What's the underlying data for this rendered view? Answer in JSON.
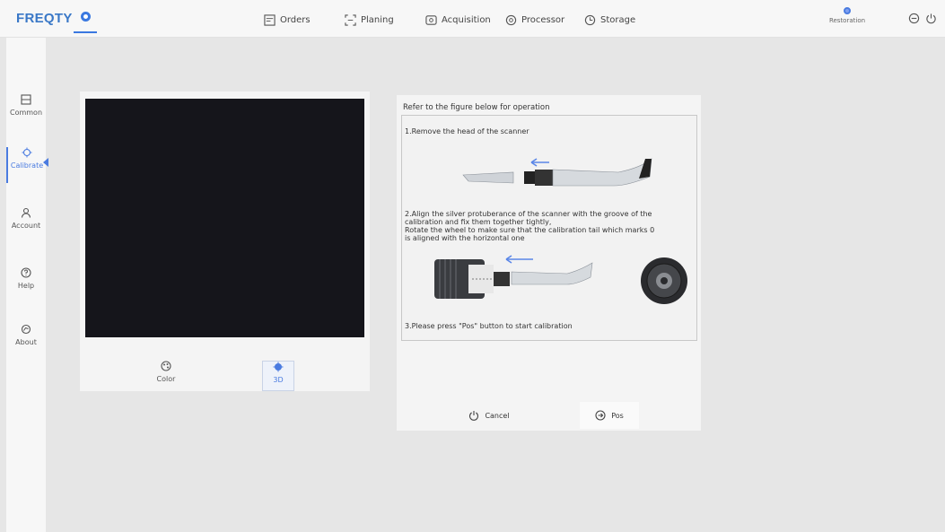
{
  "app": {
    "logo": "FREQTY",
    "logo_icon": "gear-icon"
  },
  "nav": [
    {
      "label": "Orders",
      "icon": "orders-icon"
    },
    {
      "label": "Planing",
      "icon": "planing-icon"
    },
    {
      "label": "Acquisition",
      "icon": "acquisition-icon"
    },
    {
      "label": "Processor",
      "icon": "processor-icon"
    },
    {
      "label": "Storage",
      "icon": "storage-icon"
    }
  ],
  "header_right": {
    "restoration_label": "Restoration",
    "icons": [
      "minimize-icon",
      "power-icon"
    ]
  },
  "sidebar": [
    {
      "label": "Common",
      "icon": "common-icon"
    },
    {
      "label": "Calibrate",
      "icon": "calibrate-icon",
      "active": true
    },
    {
      "label": "Account",
      "icon": "account-icon"
    },
    {
      "label": "Help",
      "icon": "help-icon"
    },
    {
      "label": "About",
      "icon": "about-icon"
    }
  ],
  "preview": {
    "modes": [
      {
        "label": "Color",
        "icon": "color-icon"
      },
      {
        "label": "3D",
        "icon": "3d-icon",
        "active": true
      }
    ]
  },
  "instructions": {
    "title": "Refer to the figure below for operation",
    "step1": "1.Remove the head of the scanner",
    "step2": "2.Align the silver protuberance of the scanner with the groove of the\n   calibration and fix them together tightly,\n   Rotate the wheel to make sure that the calibration tail which marks 0\n   is aligned with the horizontal one",
    "step3": "3.Please press \"Pos\" button to start calibration"
  },
  "actions": {
    "cancel_label": "Cancel",
    "pos_label": "Pos"
  },
  "colors": {
    "accent": "#4a7be0",
    "logo": "#3a78c7",
    "background": "#e6e6e6",
    "screen": "#15151b"
  }
}
